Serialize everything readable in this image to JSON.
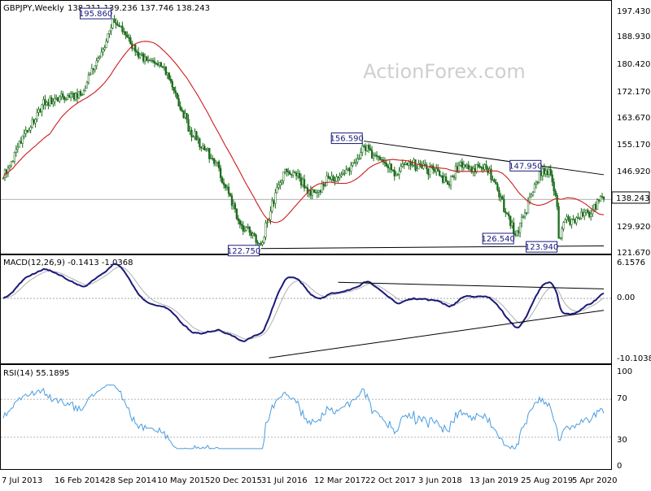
{
  "chart_data": {
    "type": "candlestick",
    "symbol_header": "GBPJPY,Weekly",
    "ohlc_header": "138.211 139.236 137.746 138.243",
    "watermark": "ActionForex.com",
    "current_price_label": "138.243",
    "x_tick_labels": [
      "7 Jul 2013",
      "16 Feb 2014",
      "28 Sep 2014",
      "10 May 2015",
      "20 Dec 2015",
      "31 Jul 2016",
      "12 Mar 2017",
      "22 Oct 2017",
      "3 Jun 2018",
      "13 Jan 2019",
      "25 Aug 2019",
      "5 Apr 2020"
    ],
    "price_panel": {
      "y_ticks": [
        "197.430",
        "188.930",
        "180.420",
        "172.170",
        "163.670",
        "155.170",
        "146.920",
        "138.243",
        "129.920",
        "121.670"
      ],
      "y_range": [
        121.67,
        197.43
      ],
      "annotations": [
        {
          "label": "195.860",
          "value": 195.86,
          "week": 68
        },
        {
          "label": "122.750",
          "value": 122.75,
          "week": 160
        },
        {
          "label": "156.590",
          "value": 156.59,
          "week": 224
        },
        {
          "label": "126.540",
          "value": 126.54,
          "week": 318
        },
        {
          "label": "147.950",
          "value": 147.95,
          "week": 335
        },
        {
          "label": "123.940",
          "value": 123.94,
          "week": 345
        }
      ],
      "resistance_line": {
        "start": [
          224,
          156.59
        ],
        "end": [
          373,
          146.0
        ]
      },
      "support_line": {
        "start": [
          160,
          122.75
        ],
        "end": [
          373,
          123.6
        ]
      },
      "anchors": [
        [
          0,
          145
        ],
        [
          8,
          154
        ],
        [
          16,
          160
        ],
        [
          24,
          168
        ],
        [
          32,
          170
        ],
        [
          40,
          171
        ],
        [
          48,
          171
        ],
        [
          56,
          179
        ],
        [
          64,
          188
        ],
        [
          68,
          195
        ],
        [
          76,
          190
        ],
        [
          84,
          183
        ],
        [
          92,
          182
        ],
        [
          100,
          180
        ],
        [
          108,
          170
        ],
        [
          116,
          160
        ],
        [
          124,
          155
        ],
        [
          132,
          150
        ],
        [
          140,
          140
        ],
        [
          148,
          130
        ],
        [
          156,
          127
        ],
        [
          160,
          124
        ],
        [
          164,
          131
        ],
        [
          170,
          142
        ],
        [
          176,
          147
        ],
        [
          184,
          145
        ],
        [
          190,
          141
        ],
        [
          196,
          141
        ],
        [
          202,
          145
        ],
        [
          208,
          145
        ],
        [
          214,
          148
        ],
        [
          220,
          151
        ],
        [
          224,
          155
        ],
        [
          230,
          152
        ],
        [
          236,
          150
        ],
        [
          244,
          146
        ],
        [
          252,
          150
        ],
        [
          260,
          148
        ],
        [
          268,
          147
        ],
        [
          276,
          143
        ],
        [
          284,
          150
        ],
        [
          292,
          148
        ],
        [
          300,
          148
        ],
        [
          306,
          143
        ],
        [
          312,
          134
        ],
        [
          318,
          127
        ],
        [
          324,
          134
        ],
        [
          330,
          143
        ],
        [
          335,
          148
        ],
        [
          340,
          146
        ],
        [
          344,
          136
        ],
        [
          345,
          126
        ],
        [
          348,
          131
        ],
        [
          354,
          132
        ],
        [
          360,
          133
        ],
        [
          366,
          135
        ],
        [
          372,
          139
        ],
        [
          373,
          138.243
        ]
      ],
      "ma": {
        "period": 30,
        "color": "#d01a1a"
      }
    },
    "macd_panel": {
      "header": "MACD(12,26,9) -0.1413 -1.0368",
      "y_ticks": [
        "6.1576",
        "0.00",
        "-10.1038"
      ],
      "y_range": [
        -10.1038,
        6.1576
      ],
      "upper_line": {
        "start": [
          208,
          2.7
        ],
        "end": [
          373,
          1.6
        ]
      },
      "lower_line": {
        "start": [
          165,
          -10.0
        ],
        "end": [
          373,
          -2.0
        ]
      }
    },
    "rsi_panel": {
      "header": "RSI(14) 55.1895",
      "y_ticks": [
        "100",
        "70",
        "30",
        "0"
      ],
      "y_range": [
        0,
        100
      ],
      "levels": [
        70,
        30
      ]
    },
    "colors": {
      "candle": "#1b6b1b",
      "ma": "#d01a1a",
      "macd_main": "#1a1a7a",
      "macd_signal": "#b0b0b0",
      "rsi": "#4a9de0",
      "annotation_border": "#1a1a7a",
      "grid": "#000000"
    }
  }
}
